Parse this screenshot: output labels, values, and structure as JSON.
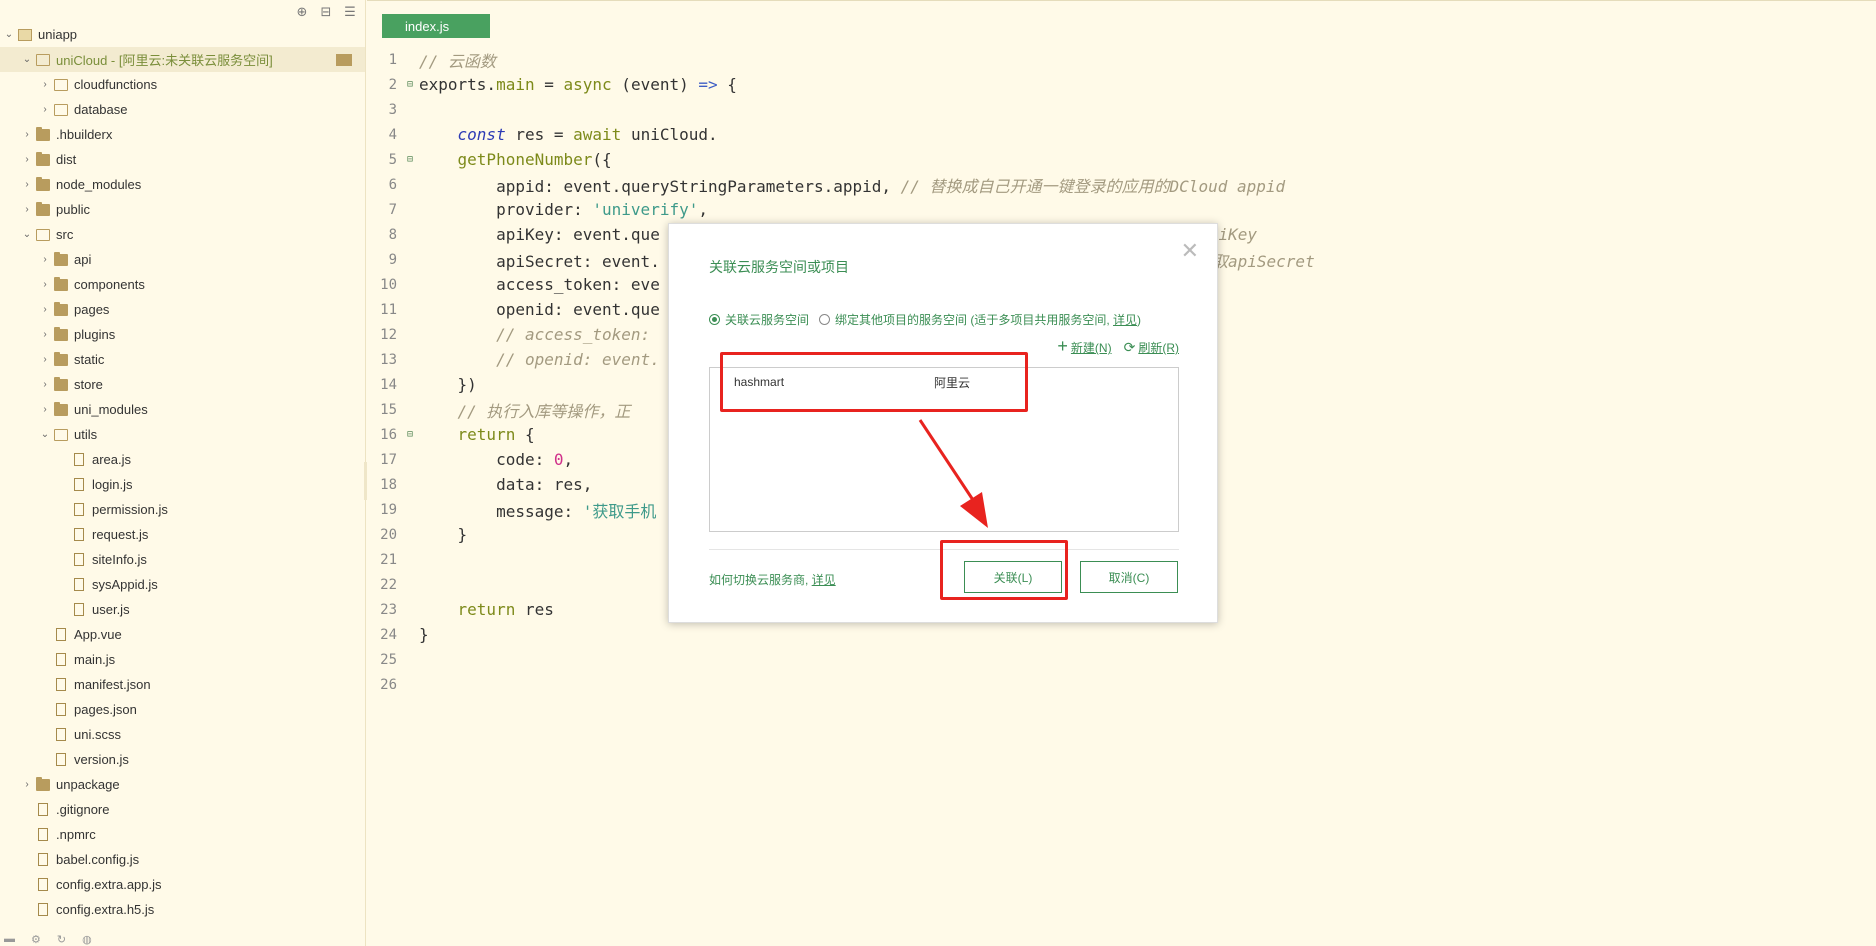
{
  "sidebar": {
    "toolbar_icons": [
      "⊕",
      "⊟",
      "☰"
    ],
    "items": [
      {
        "label": "uniapp",
        "indent": 0,
        "chevron": "v",
        "icon": "proj"
      },
      {
        "label": "uniCloud - [阿里云:未关联云服务空间]",
        "indent": 1,
        "chevron": "v",
        "icon": "folder-open",
        "selected": true,
        "cloud": true
      },
      {
        "label": "cloudfunctions",
        "indent": 2,
        "chevron": ">",
        "icon": "folder-open"
      },
      {
        "label": "database",
        "indent": 2,
        "chevron": ">",
        "icon": "folder-open"
      },
      {
        "label": ".hbuilderx",
        "indent": 1,
        "chevron": ">",
        "icon": "folder"
      },
      {
        "label": "dist",
        "indent": 1,
        "chevron": ">",
        "icon": "folder"
      },
      {
        "label": "node_modules",
        "indent": 1,
        "chevron": ">",
        "icon": "folder"
      },
      {
        "label": "public",
        "indent": 1,
        "chevron": ">",
        "icon": "folder"
      },
      {
        "label": "src",
        "indent": 1,
        "chevron": "v",
        "icon": "folder-open"
      },
      {
        "label": "api",
        "indent": 2,
        "chevron": ">",
        "icon": "folder"
      },
      {
        "label": "components",
        "indent": 2,
        "chevron": ">",
        "icon": "folder"
      },
      {
        "label": "pages",
        "indent": 2,
        "chevron": ">",
        "icon": "folder"
      },
      {
        "label": "plugins",
        "indent": 2,
        "chevron": ">",
        "icon": "folder"
      },
      {
        "label": "static",
        "indent": 2,
        "chevron": ">",
        "icon": "folder"
      },
      {
        "label": "store",
        "indent": 2,
        "chevron": ">",
        "icon": "folder"
      },
      {
        "label": "uni_modules",
        "indent": 2,
        "chevron": ">",
        "icon": "folder"
      },
      {
        "label": "utils",
        "indent": 2,
        "chevron": "v",
        "icon": "folder-open"
      },
      {
        "label": "area.js",
        "indent": 3,
        "chevron": "",
        "icon": "file"
      },
      {
        "label": "login.js",
        "indent": 3,
        "chevron": "",
        "icon": "file"
      },
      {
        "label": "permission.js",
        "indent": 3,
        "chevron": "",
        "icon": "file"
      },
      {
        "label": "request.js",
        "indent": 3,
        "chevron": "",
        "icon": "file"
      },
      {
        "label": "siteInfo.js",
        "indent": 3,
        "chevron": "",
        "icon": "file"
      },
      {
        "label": "sysAppid.js",
        "indent": 3,
        "chevron": "",
        "icon": "file"
      },
      {
        "label": "user.js",
        "indent": 3,
        "chevron": "",
        "icon": "file"
      },
      {
        "label": "App.vue",
        "indent": 2,
        "chevron": "",
        "icon": "file"
      },
      {
        "label": "main.js",
        "indent": 2,
        "chevron": "",
        "icon": "file"
      },
      {
        "label": "manifest.json",
        "indent": 2,
        "chevron": "",
        "icon": "file"
      },
      {
        "label": "pages.json",
        "indent": 2,
        "chevron": "",
        "icon": "file"
      },
      {
        "label": "uni.scss",
        "indent": 2,
        "chevron": "",
        "icon": "file"
      },
      {
        "label": "version.js",
        "indent": 2,
        "chevron": "",
        "icon": "file"
      },
      {
        "label": "unpackage",
        "indent": 1,
        "chevron": ">",
        "icon": "folder"
      },
      {
        "label": ".gitignore",
        "indent": 1,
        "chevron": "",
        "icon": "file"
      },
      {
        "label": ".npmrc",
        "indent": 1,
        "chevron": "",
        "icon": "file"
      },
      {
        "label": "babel.config.js",
        "indent": 1,
        "chevron": "",
        "icon": "file"
      },
      {
        "label": "config.extra.app.js",
        "indent": 1,
        "chevron": "",
        "icon": "file"
      },
      {
        "label": "config.extra.h5.js",
        "indent": 1,
        "chevron": "",
        "icon": "file"
      }
    ]
  },
  "editor": {
    "tab_label": "index.js",
    "lines": [
      {
        "n": "1",
        "fold": "",
        "html": "<span class='c-comment'>// 云函数</span>"
      },
      {
        "n": "2",
        "fold": "⊟",
        "html": "exports.<span class='c-fn'>main</span> = <span class='c-fn'>async</span> (event) <span class='c-op'>=&gt;</span> {"
      },
      {
        "n": "3",
        "fold": "",
        "html": ""
      },
      {
        "n": "4",
        "fold": "",
        "html": "    <span class='c-kw'>const</span> res = <span class='c-fn'>await</span> uniCloud."
      },
      {
        "n": "5",
        "fold": "⊟",
        "html": "    <span class='c-fn'>getPhoneNumber</span>({"
      },
      {
        "n": "6",
        "fold": "",
        "html": "        appid: event.queryStringParameters.appid, <span class='c-comment'>// 替换成自己开通一键登录的应用的DCloud appid</span>"
      },
      {
        "n": "7",
        "fold": "",
        "html": "        provider: <span class='c-str'>'univerify'</span>,"
      },
      {
        "n": "8",
        "fold": "",
        "html": "        apiKey: event.que                                                        <span class='c-comment'>apiKey</span>"
      },
      {
        "n": "9",
        "fold": "",
        "html": "        apiSecret: event.                                                      <span class='c-comment'>并获取apiSecret</span>"
      },
      {
        "n": "10",
        "fold": "",
        "html": "        access_token: eve"
      },
      {
        "n": "11",
        "fold": "",
        "html": "        openid: event.que"
      },
      {
        "n": "12",
        "fold": "",
        "html": "        <span class='c-comment'>// access_token:</span>"
      },
      {
        "n": "13",
        "fold": "",
        "html": "        <span class='c-comment'>// openid: event.</span>"
      },
      {
        "n": "14",
        "fold": "",
        "html": "    })"
      },
      {
        "n": "15",
        "fold": "",
        "html": "    <span class='c-comment'>// 执行入库等操作，正</span>"
      },
      {
        "n": "16",
        "fold": "⊟",
        "html": "    <span class='c-fn'>return</span> {"
      },
      {
        "n": "17",
        "fold": "",
        "html": "        code: <span class='c-num'>0</span>,"
      },
      {
        "n": "18",
        "fold": "",
        "html": "        data: res,"
      },
      {
        "n": "19",
        "fold": "",
        "html": "        message: <span class='c-str'>'获取手机</span>"
      },
      {
        "n": "20",
        "fold": "",
        "html": "    }"
      },
      {
        "n": "21",
        "fold": "",
        "html": ""
      },
      {
        "n": "22",
        "fold": "",
        "html": ""
      },
      {
        "n": "23",
        "fold": "",
        "html": "    <span class='c-fn'>return</span> res"
      },
      {
        "n": "24",
        "fold": "",
        "html": "}"
      },
      {
        "n": "25",
        "fold": "",
        "html": ""
      },
      {
        "n": "26",
        "fold": "",
        "html": ""
      }
    ]
  },
  "dialog": {
    "title": "关联云服务空间或项目",
    "close_icon": "✕",
    "radio_1": "关联云服务空间",
    "radio_2_prefix": "绑定其他项目的服务空间 (适于多项目共用服务空间, ",
    "radio_2_link": "详见",
    "radio_2_suffix": ")",
    "new_label": "新建(N)",
    "refresh_label": "刷新(R)",
    "space_name": "hashmart",
    "space_provider": "阿里云",
    "help_prefix": "如何切换云服务商, ",
    "help_link": "详见",
    "ok_label": "关联(L)",
    "cancel_label": "取消(C)"
  },
  "colors": {
    "accent_green": "#3b8e54",
    "tab_green": "#49a160",
    "annotation_red": "#e8231f",
    "background": "#fffae8"
  }
}
